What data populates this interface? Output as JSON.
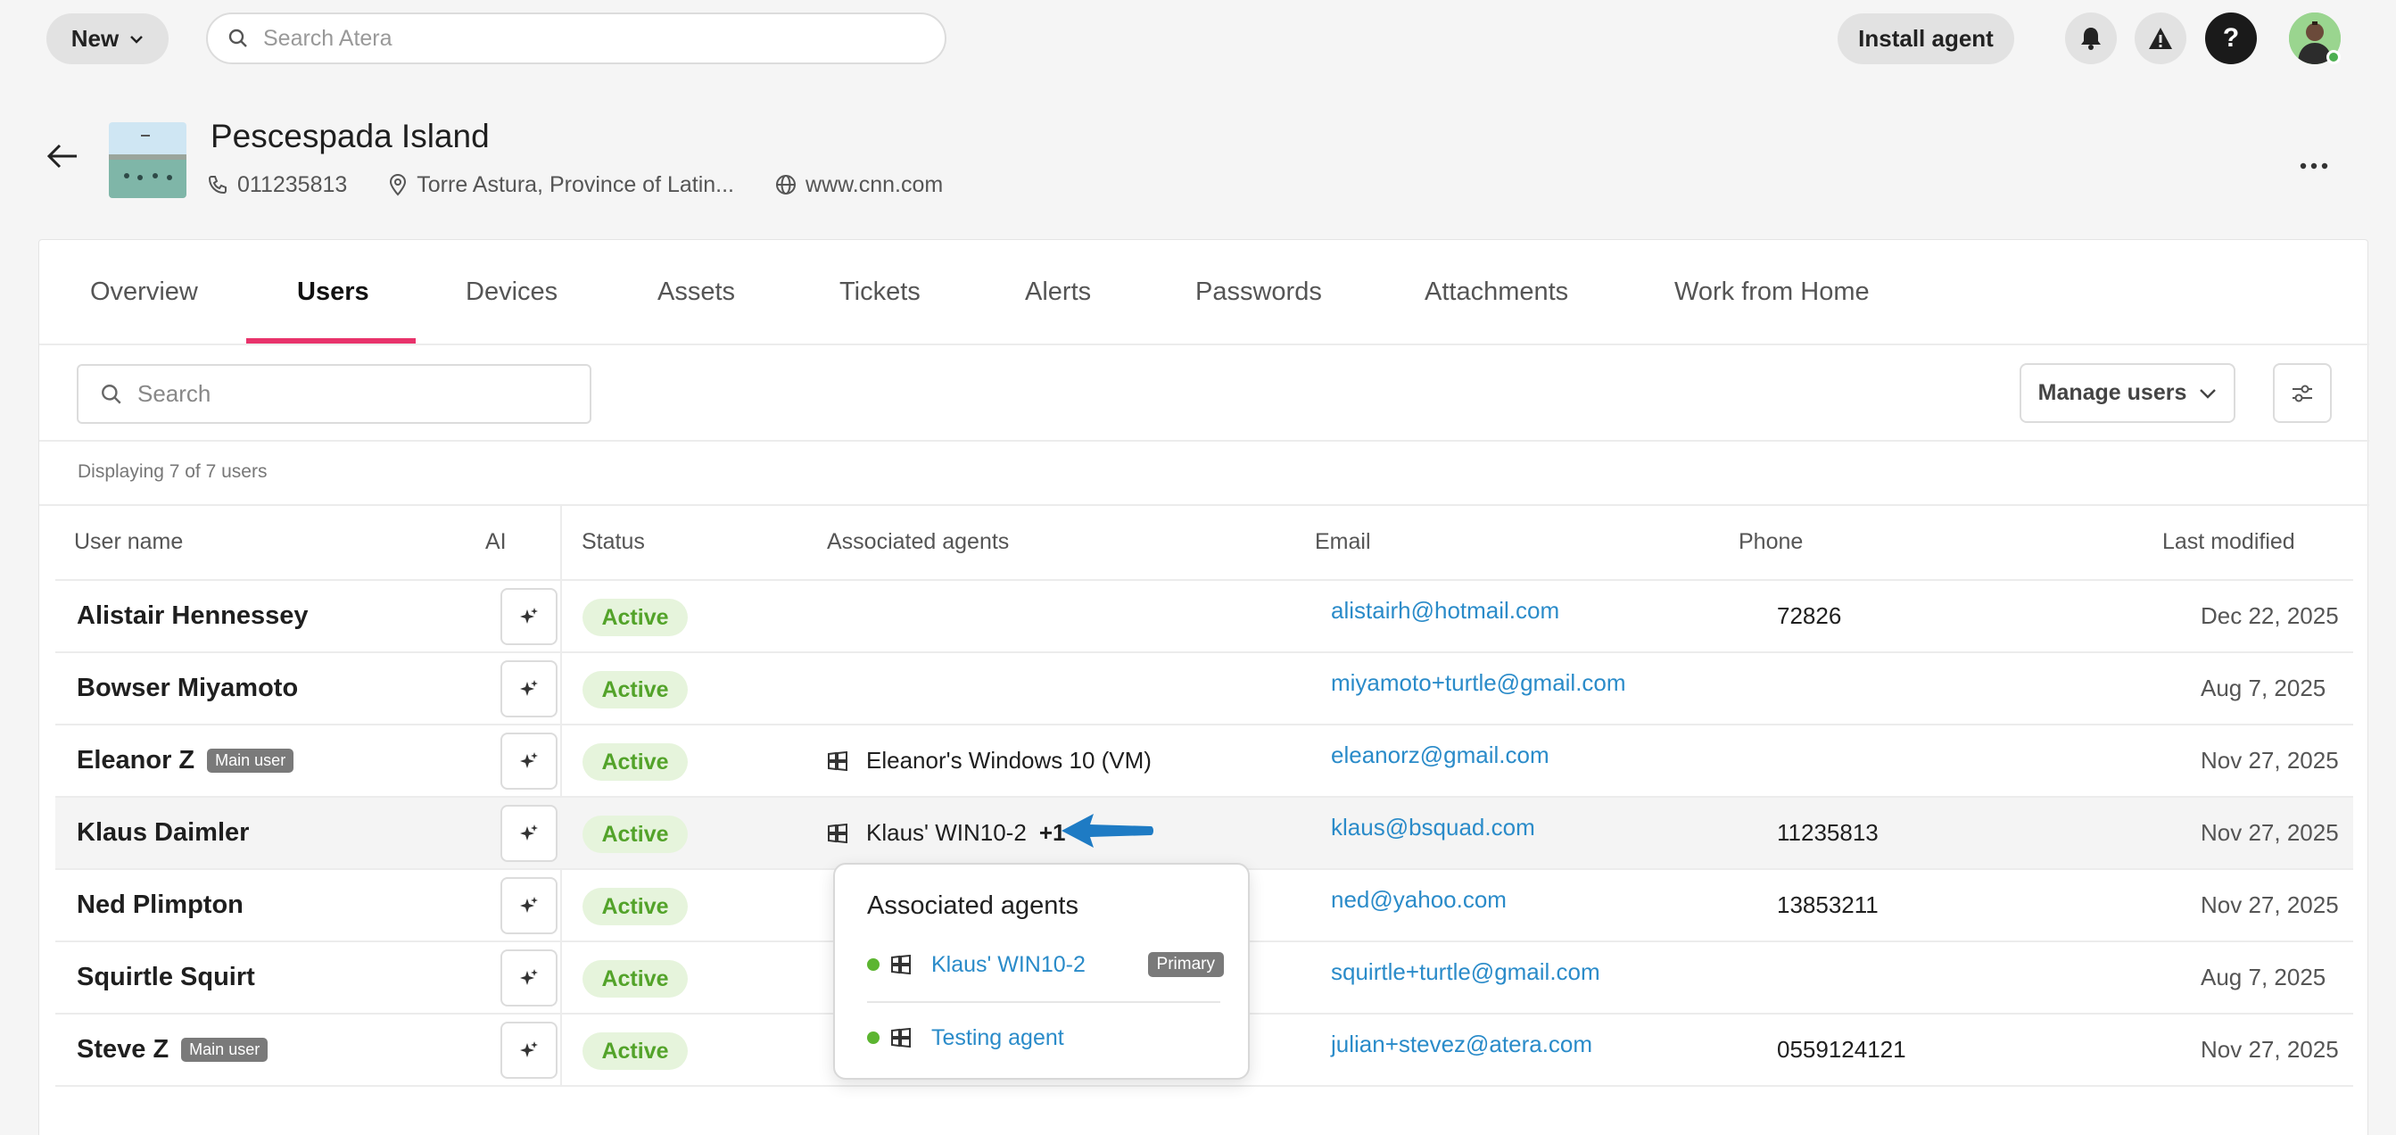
{
  "topbar": {
    "new_label": "New",
    "search_placeholder": "Search Atera",
    "install_label": "Install agent"
  },
  "customer": {
    "name": "Pescespada Island",
    "phone": "011235813",
    "address": "Torre Astura, Province of Latin...",
    "website": "www.cnn.com"
  },
  "tabs": [
    "Overview",
    "Users",
    "Devices",
    "Assets",
    "Tickets",
    "Alerts",
    "Passwords",
    "Attachments",
    "Work from Home"
  ],
  "active_tab": "Users",
  "toolbar": {
    "search_placeholder": "Search",
    "manage_users_label": "Manage users",
    "display_count": "Displaying 7 of 7 users"
  },
  "columns": {
    "user_name": "User name",
    "ai": "AI",
    "status": "Status",
    "agents": "Associated agents",
    "email": "Email",
    "phone": "Phone",
    "modified": "Last modified"
  },
  "rows": [
    {
      "name": "Alistair Hennessey",
      "badge": "",
      "status": "Active",
      "agent": "",
      "extra": "",
      "email": "alistairh@hotmail.com",
      "phone": "72826",
      "modified": "Dec 22, 2025"
    },
    {
      "name": "Bowser Miyamoto",
      "badge": "",
      "status": "Active",
      "agent": "",
      "extra": "",
      "email": "miyamoto+turtle@gmail.com",
      "phone": "",
      "modified": "Aug 7, 2025"
    },
    {
      "name": "Eleanor Z",
      "badge": "Main user",
      "status": "Active",
      "agent": "Eleanor's Windows 10 (VM)",
      "extra": "",
      "email": "eleanorz@gmail.com",
      "phone": "",
      "modified": "Nov 27, 2025"
    },
    {
      "name": "Klaus Daimler",
      "badge": "",
      "status": "Active",
      "agent": "Klaus' WIN10-2",
      "extra": "+1",
      "email": "klaus@bsquad.com",
      "phone": "11235813",
      "modified": "Nov 27, 2025"
    },
    {
      "name": "Ned Plimpton",
      "badge": "",
      "status": "Active",
      "agent": "",
      "extra": "",
      "email": "ned@yahoo.com",
      "phone": "13853211",
      "modified": "Nov 27, 2025"
    },
    {
      "name": "Squirtle Squirt",
      "badge": "",
      "status": "Active",
      "agent": "",
      "extra": "",
      "email": "squirtle+turtle@gmail.com",
      "phone": "",
      "modified": "Aug 7, 2025"
    },
    {
      "name": "Steve Z",
      "badge": "Main user",
      "status": "Active",
      "agent": "",
      "extra": "",
      "email": "julian+stevez@atera.com",
      "phone": "0559124121",
      "modified": "Nov 27, 2025"
    }
  ],
  "popover": {
    "title": "Associated agents",
    "items": [
      {
        "name": "Klaus' WIN10-2",
        "badge": "Primary"
      },
      {
        "name": "Testing agent",
        "badge": ""
      }
    ]
  },
  "colors": {
    "accent": "#e8336b",
    "link": "#2a8bc9",
    "active_bg": "#e6f4dc",
    "active_text": "#53a32a",
    "annotation_arrow": "#1e7bc4"
  },
  "icons": [
    "chevron-down-icon",
    "search-icon",
    "bell-icon",
    "warning-icon",
    "help-icon",
    "back-arrow-icon",
    "phone-icon",
    "location-icon",
    "globe-icon",
    "more-icon",
    "sliders-icon",
    "sparkle-icon",
    "windows-icon"
  ]
}
